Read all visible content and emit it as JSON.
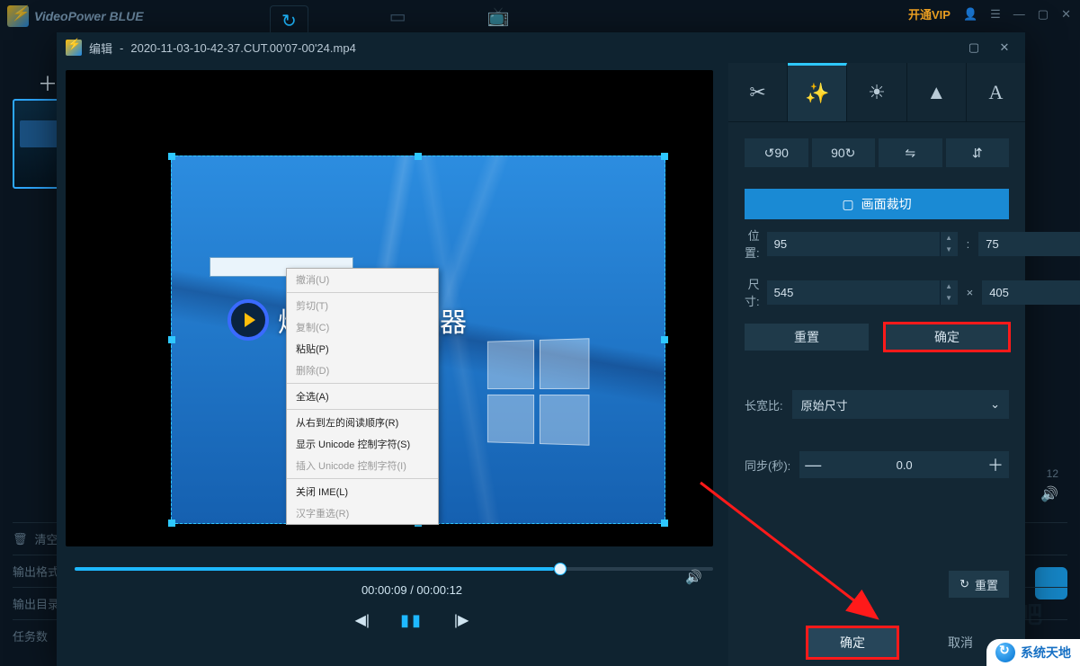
{
  "app": {
    "title": "VideoPower BLUE",
    "vip": "开通VIP"
  },
  "bg_nav": {
    "add": "＋",
    "clear": "清空",
    "out_fmt": "输出格式",
    "out_dir": "输出目录",
    "tasks": "任务数",
    "duration_hint": "12"
  },
  "editor": {
    "title_prefix": "编辑",
    "filename": "2020-11-03-10-42-37.CUT.00'07-00'24.mp4",
    "watermark": "烁光视频转换器",
    "ctx": {
      "undo": "撤消(U)",
      "cut": "剪切(T)",
      "copy": "复制(C)",
      "paste": "粘贴(P)",
      "delete": "删除(D)",
      "select_all": "全选(A)",
      "rtl": "从右到左的阅读顺序(R)",
      "show_unicode": "显示 Unicode 控制字符(S)",
      "insert_unicode": "插入 Unicode 控制字符(I)",
      "close_ime": "关闭 IME(L)",
      "reconvert": "汉字重选(R)"
    },
    "time": {
      "current": "00:00:09",
      "total": "00:00:12"
    }
  },
  "panel": {
    "crop_header": "画面裁切",
    "pos_label": "位置:",
    "pos_x": "95",
    "pos_y": "75",
    "size_label": "尺寸:",
    "size_w": "545",
    "size_h": "405",
    "reset": "重置",
    "ok": "确定",
    "aspect_label": "长宽比:",
    "aspect_value": "原始尺寸",
    "sync_label": "同步(秒):",
    "sync_value": "0.0",
    "reset2": "重置"
  },
  "footer": {
    "ok": "确定",
    "cancel": "取消"
  },
  "badge": {
    "text": "系统天地"
  },
  "ghost": "下载吧"
}
